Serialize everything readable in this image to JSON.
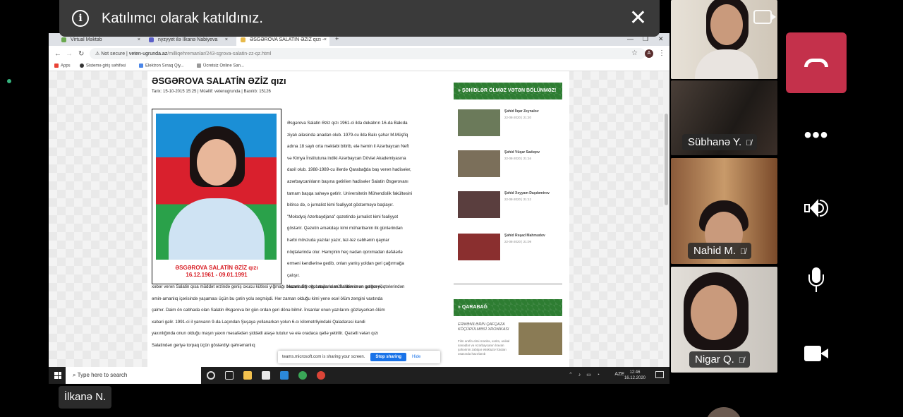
{
  "notification": {
    "message": "Katılımcı olarak katıldınız."
  },
  "browser": {
    "tabs": [
      {
        "title": "Virtual Məktəb"
      },
      {
        "title": "nyzyyet ilə İlkanə Nabiyeva"
      },
      {
        "title": "ƏSGƏROVA SALATİN ƏZİZ qızı -"
      }
    ],
    "address": {
      "security": "Not secure",
      "host": "veten-ugrunda.az",
      "path": "/milliqehremanlar/243-sgrova-salatin-zz-qz.html"
    },
    "bookmarks": [
      {
        "label": "Apps"
      },
      {
        "label": "Sistemə giriş səhifəsi"
      },
      {
        "label": "Elektron Sınaq Qiy..."
      },
      {
        "label": "Ücretsiz Online San..."
      }
    ],
    "profile_initial": "A"
  },
  "article": {
    "title": "ƏSGƏROVA SALATİN ƏZİZ qızı",
    "meta": "Tarix: 15-10-2015 15:25  |  Müəllif: vetenugrunda  |  Baxılıb: 15126",
    "photo_caption_name": "ƏSGƏROVA SALATİN ƏZİZ qızı",
    "photo_caption_dates": "16.12.1961 - 09.01.1991",
    "side_lines": [
      "Əsgərova Salatin Əziz qızı 1961-ci ildə dekabrın 16-da Bakıda",
      "ziyalı ailəsində anadan olub. 1979-cu ildə Bakı şəhər M.Müşfiq",
      "adına 18 saylı orta məktəbi bitirib, elə həmin il Azərbaycan Neft",
      "və Kimya İnstitutuna indiki Azərbaycan Dövlət Akademiyasına",
      "daxil olub. 1988-1989-cu illərdə Qarabağda baş verən hadisələr,",
      "azərbaycanlıların başına gətirilən hadisələr Salatin Əsgərovanı",
      "tamam başqa sahəyə gətirir. Universitetin Mühəndislik fakültəsini",
      "bitirsə də, o jurnalist kimi fəaliyyət göstərməyə başlayır.",
      "\"Molodyoj Azerbaydjana\" qəzetində jurnalist kimi fəaliyyət",
      "göstərir. Qəzetin əməkdaşı kimi müharibənin ilk günlərindən",
      "hərbi mövzuda yazılar yazır, tez-tez cəbhənin qaynar",
      "nöqtələrində olur. Həmçinin heç nədən qorxmadan dəfələrlə",
      "erməni kəndlərinə gedib, onları yanlış yoldan geri çağırmağa",
      "çalışır.",
      "Hazırladığı reportajlarla müharibənin ən qızğın nöqtələrindən"
    ],
    "full_lines": [
      "xəbər verən Salatin qısa müddət ərzində geniş oxucu kütləsi yığmağı bacarır. Bir oğul anası olan Salatin onun gələcəyi,",
      "əmin-amanlıq içərisində yaşaması üçün bu çətin yolu seçmişdi. Hər zaman olduğu kimi yenə əcəl ölüm zəngini vaxtında",
      "çalmır. Daim ön cəbhədə olan Salatin Əsgərova bir gün ordan geri dönə bilmir. İnsanlar onun yazılarını gözləyərkən ölüm",
      "xəbəri gəlir. 1991-ci il yanvarın 9-da Laçından Şuşaya yollanarkən yolun 6-cı kilometrliyindəki Qaladərəsi kəndi",
      "yaxınlığında onun olduğu maşın yaxın məsafədən şiddətli atəşə tutulur və elə oradaca qətlə yetirilir. Qəzətli vətən qızı",
      "Salatindən geriyə torpaq üçün göstərdiyi qəhrəmanlıq"
    ]
  },
  "sidebar": {
    "heading1": "» ŞƏHİDLƏR ÖLMƏZ VƏTƏN BÖLÜNMƏZ!",
    "news": [
      {
        "title": "Şəhid İlqar Zeynalov",
        "date": "22-08-2020 | 21:20"
      },
      {
        "title": "Şəhid Vüqar Sadıqov",
        "date": "22-08-2020 | 21:16"
      },
      {
        "title": "Şəhid Xəyyam Daşdəmirov",
        "date": "22-08-2020 | 21:12"
      },
      {
        "title": "Şəhid Rəşad Mahmudov",
        "date": "22-08-2020 | 21:09"
      }
    ],
    "heading2": "» QARABAĞ",
    "karabakh_title": "ERMƏNİLƏRİN QAFQAZA KÖÇÜRÜLMƏSİ XRONİKASI",
    "karabakh_text": "Film ərəfin elmi mənbə, xəritə, unikal sənədlər və Azərbaycanın İrəvan şəhərinin zəbtşər ekskluziv fotoları əsasında hazırlanıb"
  },
  "share_bar": {
    "message": "teams.microsoft.com is sharing your screen.",
    "stop_label": "Stop sharing",
    "hide_label": "Hide"
  },
  "taskbar": {
    "search_placeholder": "Type here to search",
    "lang": "AZE",
    "time": "12:46",
    "date": "16.12.2020"
  },
  "presenter": {
    "name": "İlkanə N."
  },
  "participants": [
    {
      "name": ""
    },
    {
      "name": "Sübhanə Y."
    },
    {
      "name": "Nahid M."
    },
    {
      "name": "Nigar Q."
    }
  ],
  "colors": {
    "hangup": "#c4314b",
    "sidebar_green": "#2e7d32",
    "caption_red": "#d81f26",
    "stop_button": "#1a73e8"
  }
}
